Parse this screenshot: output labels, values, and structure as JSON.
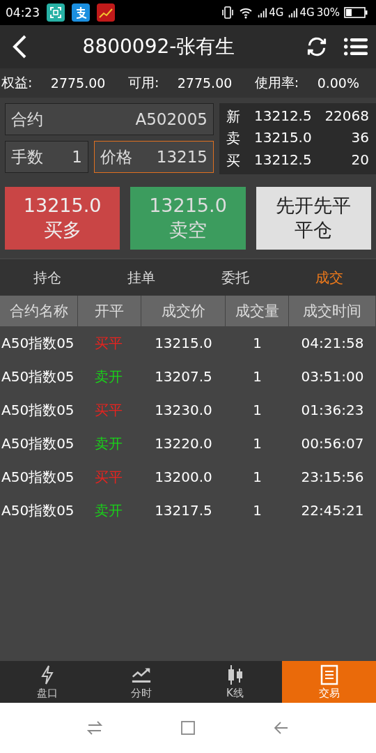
{
  "status_bar": {
    "time": "04:23",
    "network_1": "4G",
    "network_2": "4G",
    "battery": "30%"
  },
  "header": {
    "title": "8800092-张有生"
  },
  "account": [
    {
      "label": "权益:",
      "value": "2775.00"
    },
    {
      "label": "可用:",
      "value": "2775.00"
    },
    {
      "label": "使用率:",
      "value": "0.00%"
    }
  ],
  "order_form": {
    "contract": {
      "label": "合约",
      "value": "A502005"
    },
    "lots": {
      "label": "手数",
      "value": "1"
    },
    "price": {
      "label": "价格",
      "value": "13215"
    }
  },
  "quote": [
    {
      "label": "新",
      "price": "13212.5",
      "volume": "22068"
    },
    {
      "label": "卖",
      "price": "13215.0",
      "volume": "36"
    },
    {
      "label": "买",
      "price": "13212.5",
      "volume": "20"
    }
  ],
  "actions": [
    {
      "kind": "buy",
      "price": "13215.0",
      "label": "买多"
    },
    {
      "kind": "sell",
      "price": "13215.0",
      "label": "卖空"
    },
    {
      "kind": "close",
      "line_1": "先开先平",
      "line_2": "平仓"
    }
  ],
  "tabs": [
    {
      "label": "持仓",
      "selected": false
    },
    {
      "label": "挂单",
      "selected": false
    },
    {
      "label": "委托",
      "selected": false
    },
    {
      "label": "成交",
      "selected": true
    }
  ],
  "table": {
    "columns": [
      "合约名称",
      "开平",
      "成交价",
      "成交量",
      "成交时间"
    ],
    "rows": [
      {
        "name": "A50指数05",
        "side": "买平",
        "color": "#e8231f",
        "price": "13215.0",
        "qty": "1",
        "time": "04:21:58"
      },
      {
        "name": "A50指数05",
        "side": "卖开",
        "color": "#19d219",
        "price": "13207.5",
        "qty": "1",
        "time": "03:51:00"
      },
      {
        "name": "A50指数05",
        "side": "买平",
        "color": "#e8231f",
        "price": "13230.0",
        "qty": "1",
        "time": "01:36:23"
      },
      {
        "name": "A50指数05",
        "side": "卖开",
        "color": "#19d219",
        "price": "13220.0",
        "qty": "1",
        "time": "00:56:07"
      },
      {
        "name": "A50指数05",
        "side": "买平",
        "color": "#e8231f",
        "price": "13200.0",
        "qty": "1",
        "time": "23:15:56"
      },
      {
        "name": "A50指数05",
        "side": "卖开",
        "color": "#19d219",
        "price": "13217.5",
        "qty": "1",
        "time": "22:45:21"
      }
    ]
  },
  "bottom_nav": [
    {
      "kind": "bolt",
      "label": "盘口",
      "selected": false
    },
    {
      "kind": "trend",
      "label": "分时",
      "selected": false
    },
    {
      "kind": "candle",
      "label": "K线",
      "selected": false
    },
    {
      "kind": "trade",
      "label": "交易",
      "selected": true
    }
  ]
}
